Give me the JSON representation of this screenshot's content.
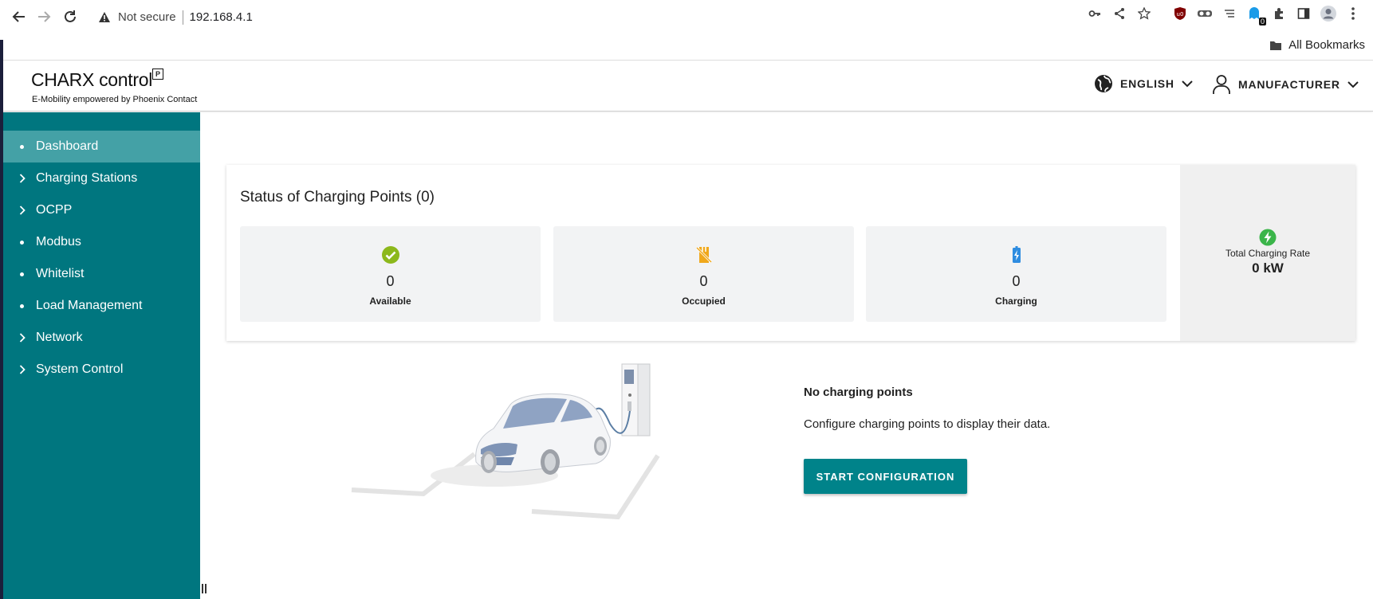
{
  "browser": {
    "security_label": "Not secure",
    "url": "192.168.4.1",
    "bookmarks_label": "All Bookmarks",
    "extension_badge": "0"
  },
  "header": {
    "logo_title": "CHARX control",
    "logo_subtitle": "E-Mobility empowered by Phoenix Contact",
    "language": "ENGLISH",
    "user_role": "MANUFACTURER"
  },
  "sidebar": {
    "items": [
      {
        "label": "Dashboard",
        "marker": "dot"
      },
      {
        "label": "Charging Stations",
        "marker": "chevron"
      },
      {
        "label": "OCPP",
        "marker": "chevron"
      },
      {
        "label": "Modbus",
        "marker": "dot"
      },
      {
        "label": "Whitelist",
        "marker": "dot"
      },
      {
        "label": "Load Management",
        "marker": "dot"
      },
      {
        "label": "Network",
        "marker": "chevron"
      },
      {
        "label": "System Control",
        "marker": "chevron"
      }
    ],
    "active_item": "Dashboard"
  },
  "status": {
    "title": "Status of Charging Points (0)",
    "available": {
      "value": "0",
      "label": "Available"
    },
    "occupied": {
      "value": "0",
      "label": "Occupied"
    },
    "charging": {
      "value": "0",
      "label": "Charging"
    },
    "total_rate": {
      "label": "Total Charging Rate",
      "value": "0 kW"
    }
  },
  "empty_state": {
    "title": "No charging points",
    "text": "Configure charging points to display their data.",
    "button": "START CONFIGURATION"
  },
  "colors": {
    "sidebar": "#00767f",
    "sidebar_active": "#44a1a6",
    "button": "#00838a",
    "available_icon": "#8cb81b",
    "occupied_icon": "#f0a81c",
    "charging_icon": "#2e8ce0",
    "rate_icon": "#3bb54a"
  }
}
